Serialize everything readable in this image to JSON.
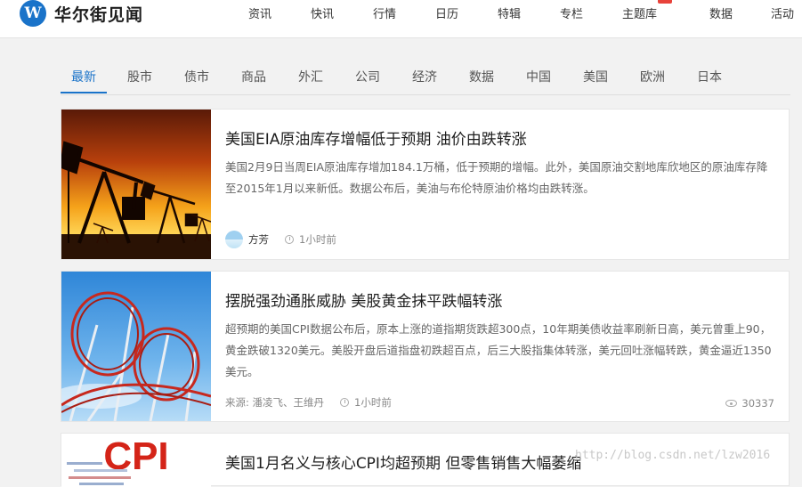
{
  "brand": {
    "name": "华尔街见闻",
    "logo_letter": "W",
    "accent": "#1a73c9"
  },
  "nav": {
    "items": [
      "资讯",
      "快讯",
      "行情",
      "日历",
      "特辑",
      "专栏",
      "主题库",
      "数据",
      "活动"
    ]
  },
  "tabs": {
    "items": [
      "最新",
      "股市",
      "债市",
      "商品",
      "外汇",
      "公司",
      "经济",
      "数据",
      "中国",
      "美国",
      "欧洲",
      "日本"
    ],
    "active": "最新"
  },
  "articles": [
    {
      "title": "美国EIA原油库存增幅低于预期 油价由跌转涨",
      "summary": "美国2月9日当周EIA原油库存增加184.1万桶，低于预期的增幅。此外，美国原油交割地库欣地区的原油库存降至2015年1月以来新低。数据公布后，美油与布伦特原油价格均由跌转涨。",
      "author": "方芳",
      "time": "1小时前",
      "image": "oil-pump-jacks-sunset"
    },
    {
      "title": "摆脱强劲通胀威胁 美股黄金抹平跌幅转涨",
      "summary": "超预期的美国CPI数据公布后，原本上涨的道指期货跌超300点，10年期美债收益率刷新日高，美元曾重上90，黄金跌破1320美元。美股开盘后道指盘初跌超百点，后三大股指集体转涨，美元回吐涨幅转跌，黄金逼近1350美元。",
      "source": "来源: 潘凌飞、王维丹",
      "time": "1小时前",
      "views": "30337",
      "image": "roller-coaster-loops"
    },
    {
      "title": "美国1月名义与核心CPI均超预期 但零售销售大幅萎缩",
      "image": "cpi-word-cloud",
      "image_text": "CPI"
    }
  ],
  "watermark": "http://blog.csdn.net/lzw2016"
}
